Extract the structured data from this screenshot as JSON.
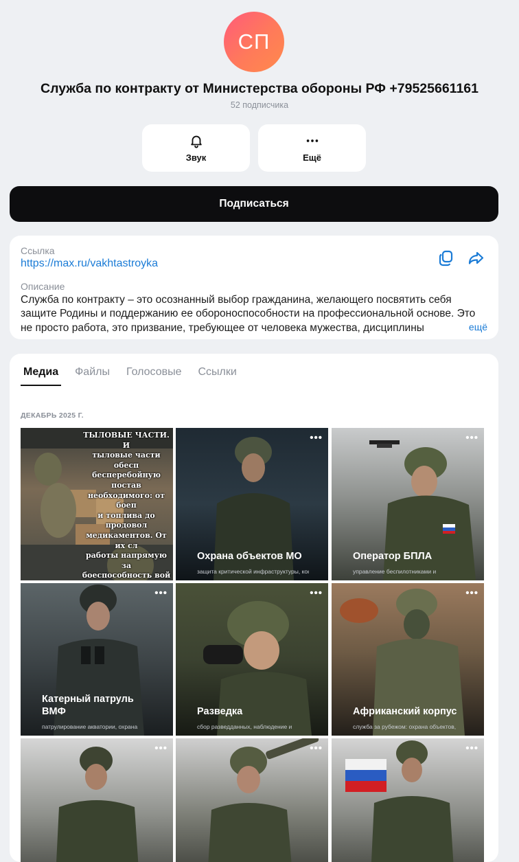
{
  "profile": {
    "avatar_initials": "СП",
    "title": "Служба по контракту от Министерства обороны РФ +79525661161",
    "subscribers": "52 подписчика"
  },
  "actions": {
    "sound_label": "Звук",
    "more_label": "Ещё"
  },
  "subscribe_label": "Подписаться",
  "info": {
    "link_label": "Ссылка",
    "link_value": "https://max.ru/vakhtastroyka",
    "description_label": "Описание",
    "description": "Служба по контракту – это осознанный выбор гражданина, желающего посвятить себя защите Родины и поддержанию ее обороноспособности на профессиональной основе. Это не просто работа, это призвание, требующее от человека мужества, дисциплины",
    "more_label": "ещё"
  },
  "media": {
    "tabs": [
      "Медиа",
      "Файлы",
      "Голосовые",
      "Ссылки"
    ],
    "active_tab": "Медиа",
    "month": "ДЕКАБРЬ 2025 Г.",
    "tiles": [
      {
        "title": "",
        "subtitle": "",
        "overlay_text": "ТЫЛОВЫЕ ЧАСТИ. И\nтыловые части обесп\nбесперебойную постав\nнеобходимого: от боеп\nи топлива до продовол\nмедикаментов. От их сл\nработы напрямую за\nбоеспособность вой\nпередовой"
      },
      {
        "title": "Охрана объектов МО",
        "subtitle": "защита критической инфраструктуры, контроль доступа и периметра",
        "overlay_text": ""
      },
      {
        "title": "Оператор БПЛА",
        "subtitle": "управление беспилотниками и",
        "overlay_text": ""
      },
      {
        "title": "Катерный патруль ВМФ",
        "subtitle": "патрулирование акватории, охрана",
        "overlay_text": ""
      },
      {
        "title": "Разведка",
        "subtitle": "сбор разведданных, наблюдение и",
        "overlay_text": ""
      },
      {
        "title": "Африканский корпус",
        "subtitle": "служба за рубежом: охрана объектов,",
        "overlay_text": ""
      },
      {
        "title": "",
        "subtitle": "",
        "overlay_text": ""
      },
      {
        "title": "",
        "subtitle": "",
        "overlay_text": ""
      },
      {
        "title": "",
        "subtitle": "",
        "overlay_text": ""
      }
    ]
  },
  "colors": {
    "background": "#eef0f3",
    "accent_link": "#1a7bd6",
    "subscribe_button": "#0d0d0f",
    "avatar_gradient_start": "#ff5b7a",
    "avatar_gradient_end": "#ff8a4c"
  },
  "icons": {
    "sound": "bell-icon",
    "more": "more-dots-icon",
    "copy": "copy-icon",
    "share": "share-icon",
    "tile_menu": "more-dots-icon"
  }
}
